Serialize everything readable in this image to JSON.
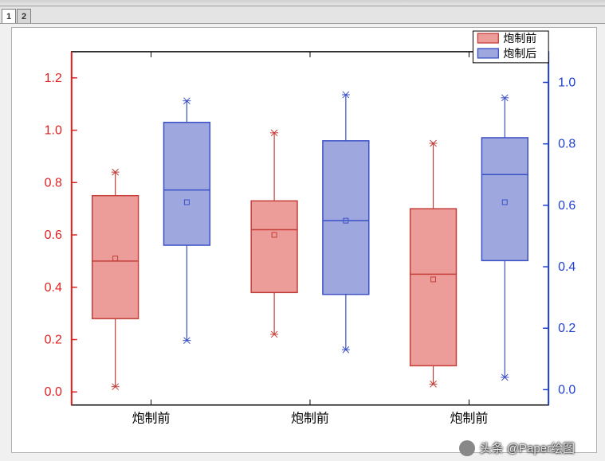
{
  "tabs": {
    "items": [
      "1",
      "2"
    ],
    "active": 0
  },
  "legend": {
    "items": [
      {
        "label": "炮制前",
        "color": "#ED9D99",
        "stroke": "#C43E3A"
      },
      {
        "label": "炮制后",
        "color": "#9EA7DE",
        "stroke": "#3B50C6"
      }
    ]
  },
  "x_categories": [
    "炮制前",
    "炮制前",
    "炮制前"
  ],
  "left_axis": {
    "color": "#E02020",
    "ticks": [
      0.0,
      0.2,
      0.4,
      0.6,
      0.8,
      1.0,
      1.2
    ],
    "min": -0.05,
    "max": 1.3
  },
  "right_axis": {
    "color": "#2040D0",
    "ticks": [
      0.0,
      0.2,
      0.4,
      0.6,
      0.8,
      1.0
    ],
    "min": -0.05,
    "max": 1.1
  },
  "chart_data": {
    "type": "boxplot",
    "title": "",
    "xlabel": "",
    "ylabel_left": "",
    "ylabel_right": "",
    "categories": [
      "炮制前",
      "炮制前",
      "炮制前"
    ],
    "series": [
      {
        "name": "炮制前",
        "color": "#ED9D99",
        "axis": "left",
        "boxes": [
          {
            "min": 0.02,
            "q1": 0.28,
            "median": 0.5,
            "q3": 0.75,
            "max": 0.84,
            "mean": 0.51
          },
          {
            "min": 0.22,
            "q1": 0.38,
            "median": 0.62,
            "q3": 0.73,
            "max": 0.99,
            "mean": 0.6
          },
          {
            "min": 0.03,
            "q1": 0.1,
            "median": 0.45,
            "q3": 0.7,
            "max": 0.95,
            "mean": 0.43
          }
        ]
      },
      {
        "name": "炮制后",
        "color": "#9EA7DE",
        "axis": "right",
        "boxes": [
          {
            "min": 0.16,
            "q1": 0.47,
            "median": 0.65,
            "q3": 0.87,
            "max": 0.94,
            "mean": 0.61
          },
          {
            "min": 0.13,
            "q1": 0.31,
            "median": 0.55,
            "q3": 0.81,
            "max": 0.96,
            "mean": 0.55
          },
          {
            "min": 0.04,
            "q1": 0.42,
            "median": 0.7,
            "q3": 0.82,
            "max": 0.95,
            "mean": 0.61
          }
        ]
      }
    ]
  },
  "watermark": "头条 @Paper绘图"
}
